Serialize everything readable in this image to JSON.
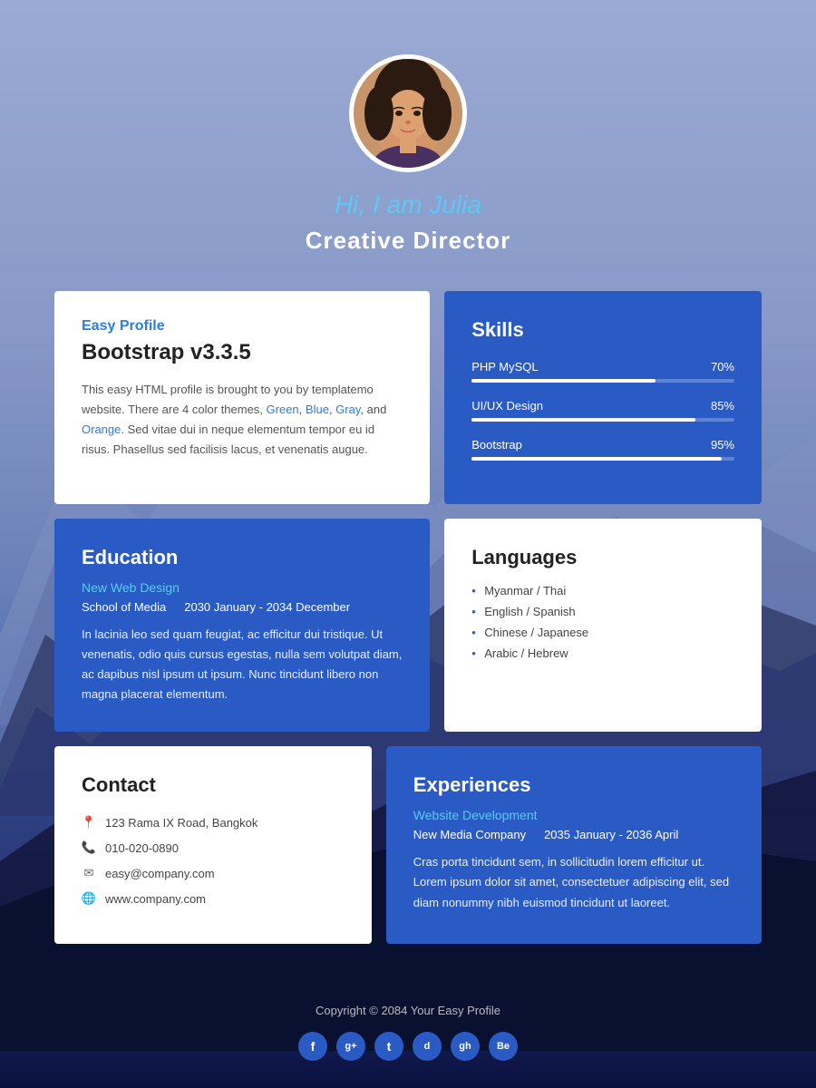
{
  "hero": {
    "greeting": "Hi, I am Julia",
    "title": "Creative Director"
  },
  "about": {
    "tag": "Easy Profile",
    "title": "Bootstrap v3.3.5",
    "description": "This easy HTML profile is brought to you by templatemo website. There are 4 color themes, Green, Blue, Gray, and Orange. Sed vitae dui in neque elementum tempor eu id risus. Phasellus sed facilisis lacus, et venenatis augue.",
    "link_green": "Green",
    "link_blue": "Blue",
    "link_gray": "Gray",
    "link_orange": "Orange"
  },
  "skills": {
    "title": "Skills",
    "items": [
      {
        "name": "PHP MySQL",
        "percent": 70,
        "label": "70%"
      },
      {
        "name": "UI/UX Design",
        "percent": 85,
        "label": "85%"
      },
      {
        "name": "Bootstrap",
        "percent": 95,
        "label": "95%"
      }
    ]
  },
  "education": {
    "title": "Education",
    "subtitle": "New Web Design",
    "school": "School of Media",
    "period": "2030 January - 2034 December",
    "description": "In lacinia leo sed quam feugiat, ac efficitur dui tristique. Ut venenatis, odio quis cursus egestas, nulla sem volutpat diam, ac dapibus nisl ipsum ut ipsum. Nunc tincidunt libero non magna placerat elementum."
  },
  "languages": {
    "title": "Languages",
    "items": [
      "Myanmar / Thai",
      "English / Spanish",
      "Chinese / Japanese",
      "Arabic / Hebrew"
    ]
  },
  "contact": {
    "title": "Contact",
    "address": "123 Rama IX Road, Bangkok",
    "phone": "010-020-0890",
    "email": "easy@company.com",
    "website": "www.company.com"
  },
  "experience": {
    "title": "Experiences",
    "subtitle": "Website Development",
    "company": "New Media Company",
    "period": "2035 January - 2036 April",
    "description": "Cras porta tincidunt sem, in sollicitudin lorem efficitur ut. Lorem ipsum dolor sit amet, consectetuer adipiscing elit, sed diam nonummy nibh euismod tincidunt ut laoreet."
  },
  "footer": {
    "copyright": "Copyright © 2084 Your Easy Profile",
    "social": [
      "f",
      "g+",
      "t",
      "d",
      "gh",
      "Be"
    ]
  }
}
